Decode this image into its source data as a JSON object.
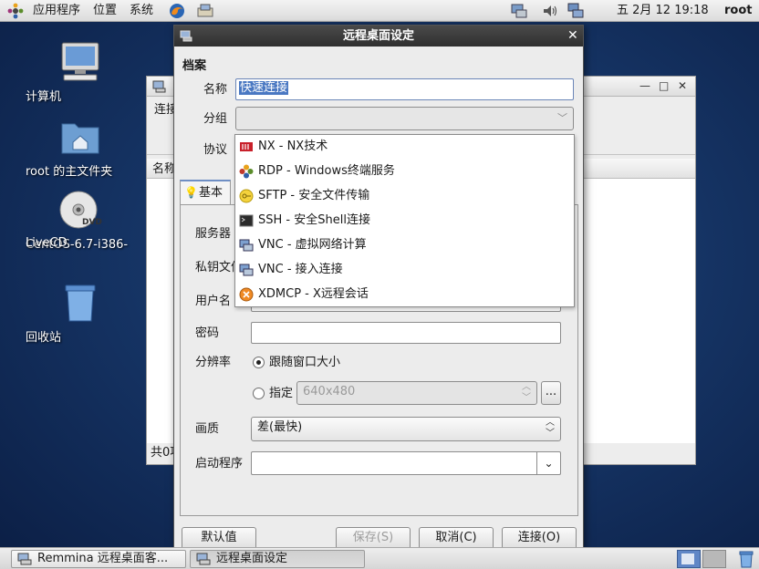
{
  "top_panel": {
    "applications": "应用程序",
    "places": "位置",
    "system": "系统",
    "clock": "五 2月 12 19:18",
    "user": "root"
  },
  "desktop_icons": [
    {
      "label": "计算机",
      "icon": "computer-icon"
    },
    {
      "label": "root 的主文件夹",
      "icon": "home-folder-icon"
    },
    {
      "label": "CentOS-6.7-i386-LiveCD",
      "label_line1": "CentOS-6.7-i386-",
      "label_line2": "LiveCD",
      "icon": "dvd-icon"
    },
    {
      "label": "回收站",
      "icon": "trash-icon"
    }
  ],
  "bg_window": {
    "menu_connection": "连接",
    "col_name": "名称",
    "status": "共0项"
  },
  "dialog": {
    "title": "远程桌面设定",
    "profile_section": "档案",
    "name_label": "名称",
    "name_value": "快速连接",
    "group_label": "分组",
    "group_value": "",
    "protocol_label": "协议",
    "tab_basic": "基本",
    "server_label": "服务器",
    "key_file_label": "私钥文件",
    "username_label": "用户名",
    "password_label": "密码",
    "resolution_label": "分辨率",
    "resolution_follow": "跟随窗口大小",
    "resolution_custom": "指定",
    "resolution_custom_value": "640x480",
    "browse_button": "...",
    "quality_label": "画质",
    "quality_value": "差(最快)",
    "startup_label": "启动程序",
    "startup_value": "",
    "btn_default": "默认值",
    "btn_save": "保存(S)",
    "btn_cancel": "取消(C)",
    "btn_connect": "连接(O)"
  },
  "protocol_menu": [
    {
      "label": "NX - NX技术",
      "icon": "nx-icon"
    },
    {
      "label": "RDP - Windows终端服务",
      "icon": "rdp-icon"
    },
    {
      "label": "SFTP - 安全文件传输",
      "icon": "sftp-icon"
    },
    {
      "label": "SSH - 安全Shell连接",
      "icon": "ssh-terminal-icon"
    },
    {
      "label": "VNC - 虚拟网络计算",
      "icon": "vnc-icon"
    },
    {
      "label": "VNC - 接入连接",
      "icon": "vnc-incoming-icon"
    },
    {
      "label": "XDMCP - X远程会话",
      "icon": "xdmcp-icon"
    }
  ],
  "taskbar": [
    {
      "label": "Remmina 远程桌面客..."
    },
    {
      "label": "远程桌面设定"
    }
  ],
  "colors": {
    "desktop": "#163566",
    "titlebar": "#3a3a3a",
    "selection": "#4a78c2"
  }
}
